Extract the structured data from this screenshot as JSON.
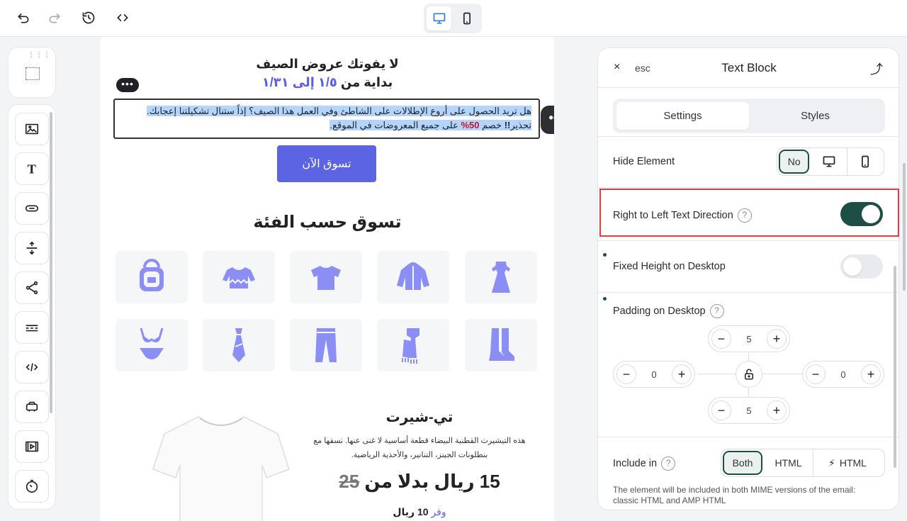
{
  "toolbar": {
    "undo": "undo-icon",
    "redo": "redo-icon",
    "history": "history-icon",
    "code": "code-icon",
    "device_desktop": "desktop-icon",
    "device_mobile": "mobile-icon"
  },
  "left_tools": [
    "image-icon",
    "text-icon",
    "button-icon",
    "spacer-icon",
    "share-icon",
    "divider-icon",
    "html-icon",
    "menu-icon",
    "video-icon",
    "timer-icon"
  ],
  "email": {
    "headline1": "لا يفوتك عروض الصيف",
    "headline2_prefix": "بداية من ",
    "headline2_dates": "١/٥ إلى ١/٣١",
    "text_part1": "هل تريد الحصول على أروع الإطلالات على الشاطئ وفي العمل هذا الصيف؟ إذاً ستنال تشكيلتنا إعجابك. تحذير",
    "text_bang": "!!",
    "text_part2": " خصم ",
    "text_discount": "50%",
    "text_part3": " على جميع المعروضات في الموقع.",
    "cta": "تسوق الآن",
    "categories_title": "تسوق حسب الفئة",
    "product_title": "تي-شيرت",
    "product_desc": "هذه التيشيرت القطنية البيضاء قطعة أساسية لا غنى عنها. نسقها مع بنطلونات الجينز، التنانير، والأحذية الرياضية.",
    "price_new": "15 ريال بدلا من ",
    "price_old": "25",
    "save_prefix": "وفر",
    "save_amount": " 10 ريال"
  },
  "panel": {
    "close": "×",
    "esc": "esc",
    "title": "Text Block",
    "tab_settings": "Settings",
    "tab_styles": "Styles",
    "hide_label": "Hide Element",
    "hide_no": "No",
    "rtl_label": "Right to Left Text Direction",
    "rtl_on": true,
    "fixed_label": "Fixed Height on Desktop",
    "fixed_on": false,
    "padding_label": "Padding on Desktop",
    "pad_top": "5",
    "pad_left": "0",
    "pad_right": "0",
    "pad_bottom": "5",
    "include_label": "Include in",
    "include_both": "Both",
    "include_html": "HTML",
    "include_amp": "HTML",
    "note": "The element will be included in both MIME versions of the email: classic HTML and AMP HTML",
    "help": "?"
  },
  "colors": {
    "accent": "#1d4f46",
    "brand": "#5d64e4",
    "highlight": "#e43c3c"
  }
}
